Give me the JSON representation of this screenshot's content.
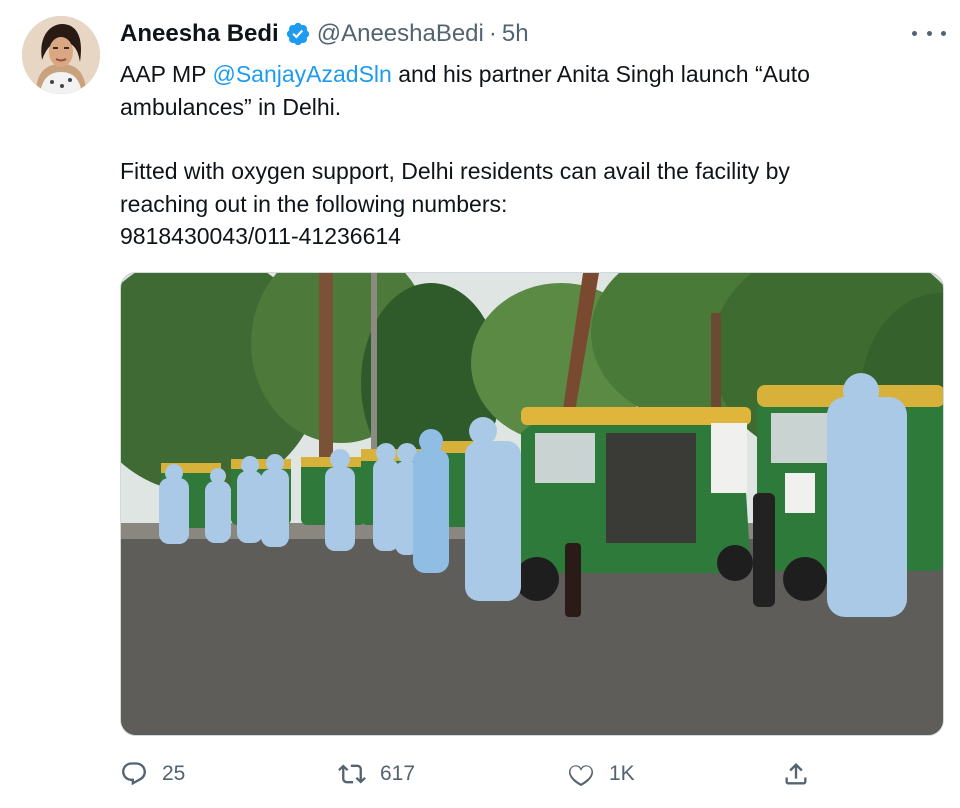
{
  "author": {
    "display_name": "Aneesha Bedi",
    "handle": "@AneeshaBedi",
    "separator": "·",
    "time": "5h",
    "verified_icon": "verified-badge-icon"
  },
  "tweet": {
    "line1_pre": "AAP MP ",
    "mention": "@SanjayAzadSln",
    "line1_post": " and his partner Anita Singh launch “Auto",
    "line2": "ambulances” in Delhi.",
    "line3": "Fitted with oxygen support, Delhi residents can avail the facility by",
    "line4": "reaching out in the following numbers:",
    "line5": "9818430043/011-41236614"
  },
  "actions": {
    "reply_count": "25",
    "retweet_count": "617",
    "like_count": "1K"
  },
  "colors": {
    "accent": "#1d9bf0",
    "secondary_text": "#536471",
    "primary_text": "#0f1419"
  }
}
